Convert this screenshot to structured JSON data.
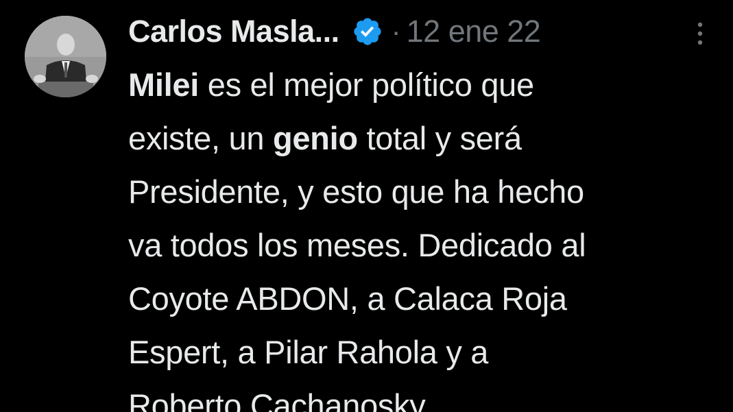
{
  "tweet": {
    "author_name": "Carlos Masla...",
    "separator": "·",
    "date": "12 ene 22",
    "colors": {
      "background": "#000000",
      "text": "#e7e9ea",
      "secondary": "#71767b",
      "verified": "#1d9bf0"
    },
    "icons": {
      "avatar": "profile-photo",
      "verified": "verified-badge-icon",
      "more": "more-options-icon"
    },
    "lines": [
      {
        "b1": "Milei",
        "t1": " es el mejor político que"
      },
      {
        "t1": "existe, un ",
        "b1": "genio",
        "t2": " total y será"
      },
      {
        "t1": "Presidente, y esto que ha hecho"
      },
      {
        "t1": "va todos los meses. Dedicado al"
      },
      {
        "t1": "Coyote ABDON, a Calaca Roja"
      },
      {
        "t1": "Espert, a Pilar Rahola y a"
      },
      {
        "t1": "Roberto Cachanosky."
      }
    ]
  }
}
